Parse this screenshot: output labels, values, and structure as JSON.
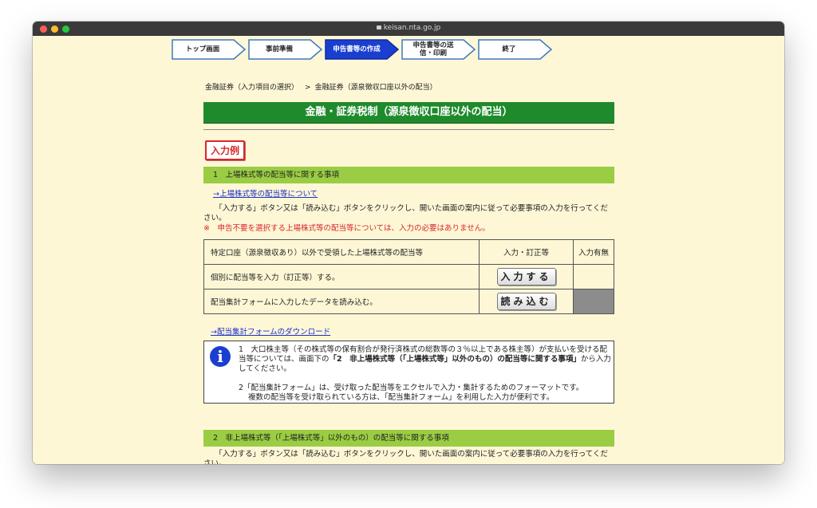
{
  "browser": {
    "url": "keisan.nta.go.jp"
  },
  "steps": [
    {
      "label": "トップ画面",
      "current": false
    },
    {
      "label": "事前準備",
      "current": false
    },
    {
      "label": "申告書等の作成",
      "current": true
    },
    {
      "label": "申告書等の送信・印刷",
      "current": false
    },
    {
      "label": "終了",
      "current": false
    }
  ],
  "breadcrumb": {
    "parent": "金融証券（入力項目の選択）",
    "separator": ">",
    "current": "金融証券（源泉徴収口座以外の配当）"
  },
  "page_title": "金融・証券税制（源泉徴収口座以外の配当）",
  "example_badge": "入力例",
  "section1": {
    "heading": "1　上場株式等の配当等に関する事項",
    "about_link": "→上場株式等の配当等について",
    "instruction": "「入力する」ボタン又は「読み込む」ボタンをクリックし、開いた画面の案内に従って必要事項の入力を行ってください。",
    "warning": "※　申告不要を選択する上場株式等の配当等については、入力の必要はありません。",
    "table": {
      "header": [
        "特定口座（源泉徴収あり）以外で受領した上場株式等の配当等",
        "入力・訂正等",
        "入力有無"
      ],
      "rows": [
        {
          "label": "個別に配当等を入力（訂正等）する。",
          "button": "入力する"
        },
        {
          "label": "配当集計フォームに入力したデータを読み込む。",
          "button": "読み込む"
        }
      ]
    },
    "download_link": "→配当集計フォームのダウンロード"
  },
  "info_box": {
    "icon": "info-icon",
    "item1_pre": "1　大口株主等（その株式等の保有割合が発行済株式の総数等の３％以上である株主等）が支払いを受ける配当等については、画面下の",
    "item1_bold": "「2　非上場株式等（「上場株式等」以外のもの）の配当等に関する事項」",
    "item1_post": "から入力してください。",
    "item2_line1": "2「配当集計フォーム」は、受け取った配当等をエクセルで入力・集計するためのフォーマットです。",
    "item2_line2": "複数の配当等を受け取られている方は、「配当集計フォーム」を利用した入力が便利です。"
  },
  "section2": {
    "heading": "2　非上場株式等（「上場株式等」以外のもの）の配当等に関する事項",
    "instruction": "「入力する」ボタン又は「読み込む」ボタンをクリックし、開いた画面の案内に従って必要事項の入力を行ってください。"
  },
  "colors": {
    "page_bg": "#fdf7d6",
    "title_green": "#1f8a2c",
    "section_green": "#9acd43",
    "link_blue": "#1c2fcc",
    "warning_red": "#d9262a",
    "step_current": "#1a3fd0"
  }
}
